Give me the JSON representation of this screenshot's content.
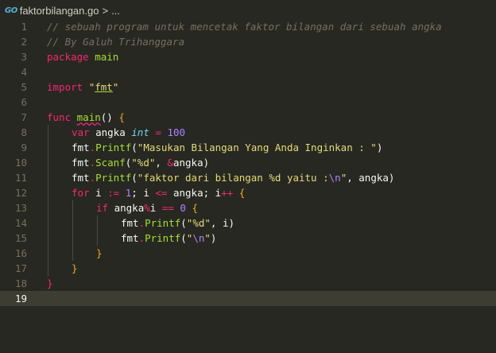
{
  "breadcrumb": {
    "go_icon": "GO",
    "file": "faktorbilangan.go",
    "separator": ">",
    "more": "..."
  },
  "current_line": 19,
  "lines": [
    {
      "n": 1,
      "indent": 0,
      "tokens": [
        {
          "t": "// sebuah program untuk mencetak faktor bilangan dari sebuah angka",
          "c": "comment"
        }
      ]
    },
    {
      "n": 2,
      "indent": 0,
      "tokens": [
        {
          "t": "// By Galuh Trihanggara",
          "c": "comment"
        }
      ]
    },
    {
      "n": 3,
      "indent": 0,
      "tokens": [
        {
          "t": "package",
          "c": "keyword"
        },
        {
          "t": " "
        },
        {
          "t": "main",
          "c": "func"
        }
      ]
    },
    {
      "n": 4,
      "indent": 0,
      "tokens": []
    },
    {
      "n": 5,
      "indent": 0,
      "tokens": [
        {
          "t": "import",
          "c": "keyword"
        },
        {
          "t": " "
        },
        {
          "t": "\"",
          "c": "string"
        },
        {
          "t": "fmt",
          "c": "string underline"
        },
        {
          "t": "\"",
          "c": "string"
        }
      ]
    },
    {
      "n": 6,
      "indent": 0,
      "tokens": []
    },
    {
      "n": 7,
      "indent": 0,
      "tokens": [
        {
          "t": "func",
          "c": "keyword"
        },
        {
          "t": " "
        },
        {
          "t": "main",
          "c": "func squiggle"
        },
        {
          "t": "() "
        },
        {
          "t": "{",
          "c": "brace"
        }
      ]
    },
    {
      "n": 8,
      "indent": 1,
      "tokens": [
        {
          "t": "var",
          "c": "keyword"
        },
        {
          "t": " angka "
        },
        {
          "t": "int",
          "c": "type"
        },
        {
          "t": " "
        },
        {
          "t": "=",
          "c": "keyword"
        },
        {
          "t": " "
        },
        {
          "t": "100",
          "c": "number"
        }
      ]
    },
    {
      "n": 9,
      "indent": 1,
      "tokens": [
        {
          "t": "fmt"
        },
        {
          "t": ".",
          "c": "keyword"
        },
        {
          "t": "Printf",
          "c": "func"
        },
        {
          "t": "("
        },
        {
          "t": "\"Masukan Bilangan Yang Anda Inginkan : \"",
          "c": "string"
        },
        {
          "t": ")"
        }
      ]
    },
    {
      "n": 10,
      "indent": 1,
      "tokens": [
        {
          "t": "fmt"
        },
        {
          "t": ".",
          "c": "keyword"
        },
        {
          "t": "Scanf",
          "c": "func"
        },
        {
          "t": "("
        },
        {
          "t": "\"%d\"",
          "c": "string"
        },
        {
          "t": ", "
        },
        {
          "t": "&",
          "c": "keyword"
        },
        {
          "t": "angka)"
        }
      ]
    },
    {
      "n": 11,
      "indent": 1,
      "tokens": [
        {
          "t": "fmt"
        },
        {
          "t": ".",
          "c": "keyword"
        },
        {
          "t": "Printf",
          "c": "func"
        },
        {
          "t": "("
        },
        {
          "t": "\"faktor dari bilangan %d yaitu :",
          "c": "string"
        },
        {
          "t": "\\n",
          "c": "escape"
        },
        {
          "t": "\"",
          "c": "string"
        },
        {
          "t": ", angka)"
        }
      ]
    },
    {
      "n": 12,
      "indent": 1,
      "tokens": [
        {
          "t": "for",
          "c": "keyword"
        },
        {
          "t": " i "
        },
        {
          "t": ":=",
          "c": "keyword"
        },
        {
          "t": " "
        },
        {
          "t": "1",
          "c": "number"
        },
        {
          "t": "; i "
        },
        {
          "t": "<=",
          "c": "keyword"
        },
        {
          "t": " angka; i"
        },
        {
          "t": "++",
          "c": "keyword"
        },
        {
          "t": " "
        },
        {
          "t": "{",
          "c": "brace"
        }
      ]
    },
    {
      "n": 13,
      "indent": 2,
      "tokens": [
        {
          "t": "if",
          "c": "keyword"
        },
        {
          "t": " angka"
        },
        {
          "t": "%",
          "c": "keyword"
        },
        {
          "t": "i "
        },
        {
          "t": "==",
          "c": "keyword"
        },
        {
          "t": " "
        },
        {
          "t": "0",
          "c": "number"
        },
        {
          "t": " "
        },
        {
          "t": "{",
          "c": "brace"
        }
      ]
    },
    {
      "n": 14,
      "indent": 3,
      "tokens": [
        {
          "t": "fmt"
        },
        {
          "t": ".",
          "c": "keyword"
        },
        {
          "t": "Printf",
          "c": "func"
        },
        {
          "t": "("
        },
        {
          "t": "\"%d\"",
          "c": "string"
        },
        {
          "t": ", i)"
        }
      ]
    },
    {
      "n": 15,
      "indent": 3,
      "tokens": [
        {
          "t": "fmt"
        },
        {
          "t": ".",
          "c": "keyword"
        },
        {
          "t": "Printf",
          "c": "func"
        },
        {
          "t": "("
        },
        {
          "t": "\"",
          "c": "string"
        },
        {
          "t": "\\n",
          "c": "escape"
        },
        {
          "t": "\"",
          "c": "string"
        },
        {
          "t": ")"
        }
      ]
    },
    {
      "n": 16,
      "indent": 2,
      "tokens": [
        {
          "t": "}",
          "c": "brace"
        }
      ]
    },
    {
      "n": 17,
      "indent": 1,
      "tokens": [
        {
          "t": "}",
          "c": "brace"
        }
      ]
    },
    {
      "n": 18,
      "indent": 0,
      "tokens": [
        {
          "t": "}",
          "c": "keyword"
        }
      ]
    },
    {
      "n": 19,
      "indent": 0,
      "tokens": []
    }
  ]
}
